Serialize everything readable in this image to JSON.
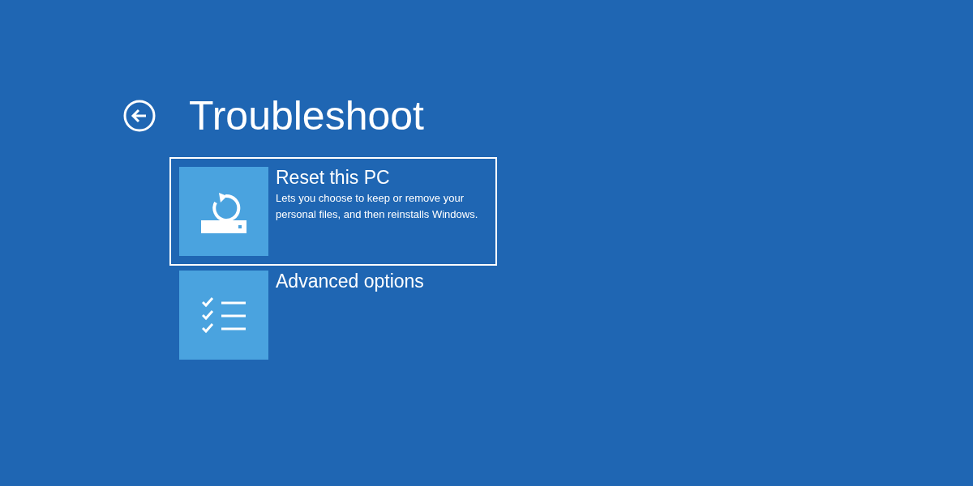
{
  "title": "Troubleshoot",
  "options": [
    {
      "kind": "reset",
      "label": "Reset this PC",
      "description": "Lets you choose to keep or remove your personal files, and then reinstalls Windows.",
      "selected": true
    },
    {
      "kind": "advanced",
      "label": "Advanced options",
      "selected": false
    }
  ]
}
